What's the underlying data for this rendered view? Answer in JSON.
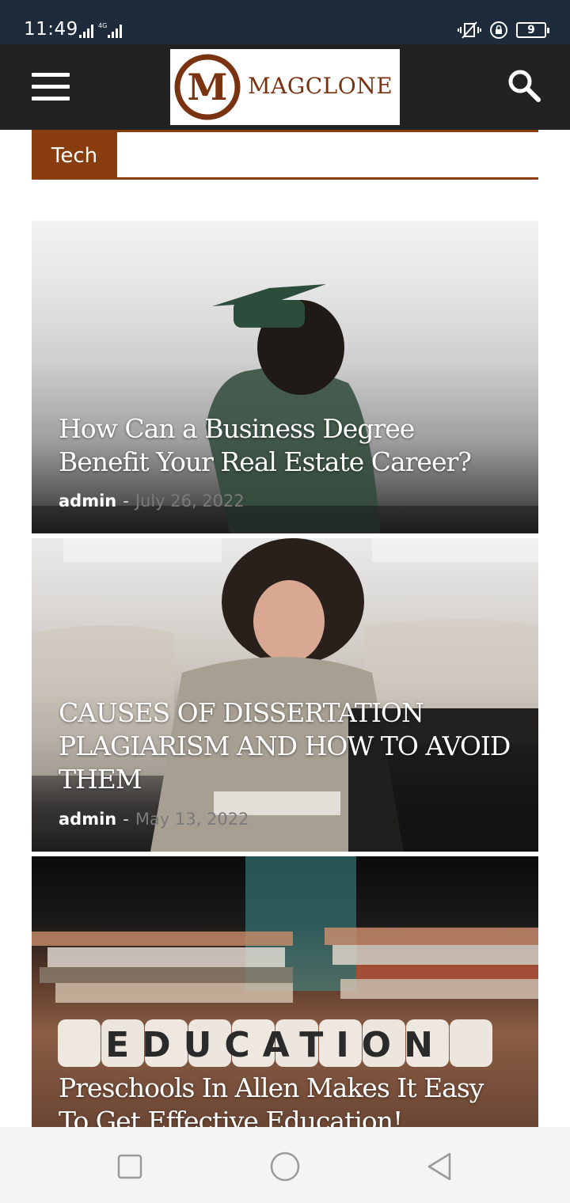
{
  "status_bar": {
    "time": "11:49",
    "battery": "9"
  },
  "header": {
    "logo_letter": "M",
    "logo_text": "MAGCLONE",
    "brand_color": "#7a3311"
  },
  "category": {
    "label": "Tech",
    "accent_color": "#8a3e10"
  },
  "articles": [
    {
      "title": "How Can a Business Degree Benefit Your Real Estate Career?",
      "author": "admin",
      "separator": "-",
      "date": "July 26, 2022"
    },
    {
      "title": "CAUSES OF DISSERTATION PLAGIARISM AND HOW TO AVOID THEM",
      "author": "admin",
      "separator": "-",
      "date": "May 13, 2022"
    },
    {
      "title": "Preschools In Allen Makes It Easy To Get Effective Education!",
      "image_text": "EDUCATION"
    }
  ],
  "icons": {
    "menu": "hamburger-menu-icon",
    "search": "search-icon",
    "nav_recent": "square-icon",
    "nav_home": "circle-icon",
    "nav_back": "triangle-back-icon"
  }
}
